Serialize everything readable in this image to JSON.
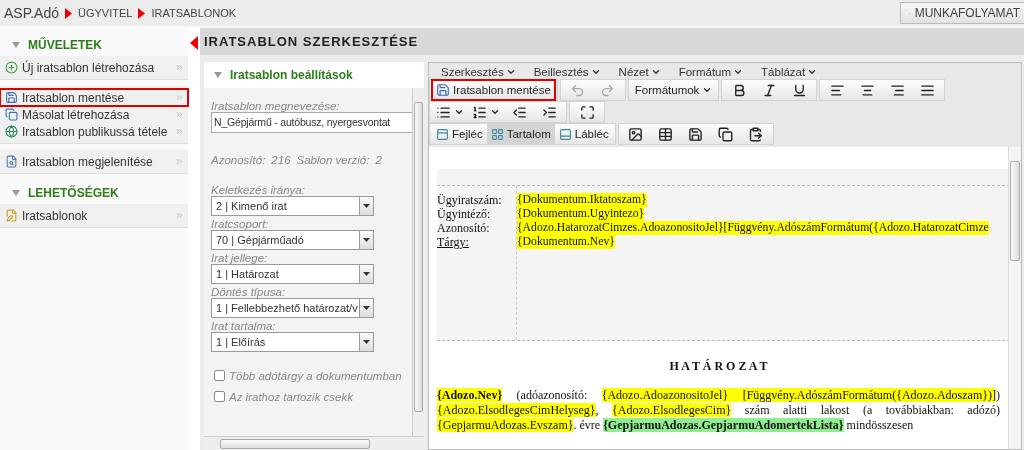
{
  "breadcrumb": [
    {
      "label": "ASP.Adó"
    },
    {
      "label": "ÜGYVITEL"
    },
    {
      "label": "IRATSABLONOK"
    }
  ],
  "workflow_button": {
    "label": "MUNKAFOLYAMAT"
  },
  "sidebar": {
    "sections": [
      {
        "title": "MŰVELETEK",
        "expanded": true,
        "groups": [
          [
            {
              "kind": "add",
              "label": "Új iratsablon létrehozása",
              "highlighted": false
            }
          ],
          [
            {
              "kind": "save",
              "label": "Iratsablon mentése",
              "highlighted": true
            },
            {
              "kind": "copy",
              "label": "Másolat létrehozása",
              "highlighted": false
            },
            {
              "kind": "publish",
              "label": "Iratsablon publikussá tétele",
              "highlighted": false
            }
          ],
          [
            {
              "kind": "view",
              "label": "Iratsablon megjelenítése",
              "highlighted": false
            }
          ]
        ]
      },
      {
        "title": "LEHETŐSÉGEK",
        "expanded": true,
        "groups": [
          [
            {
              "kind": "edit",
              "label": "Iratsablonok",
              "highlighted": false
            }
          ]
        ]
      }
    ]
  },
  "page_title": "IRATSABLON SZERKESZTÉSE",
  "settings": {
    "title": "Iratsablon beállítások",
    "expanded": true,
    "name_field": {
      "label": "Iratsablon megnevezése:",
      "value": "N_Gépjármű - autóbusz, nyergesvontat"
    },
    "info": [
      {
        "label": "Azonosító:",
        "value": "216"
      },
      {
        "label": "Sablon verzió:",
        "value": "2"
      }
    ],
    "selects": [
      {
        "label": "Keletkezés iránya:",
        "value": "2 | Kimenő irat"
      },
      {
        "label": "Iratcsoport:",
        "value": "70 | Gépjárműadó"
      },
      {
        "label": "Irat jellege:",
        "value": "1 | Határozat"
      },
      {
        "label": "Döntés típusa:",
        "value": "1 | Fellebbezhető határozat/v"
      },
      {
        "label": "Irat tartalma:",
        "value": "1 | Előírás"
      }
    ],
    "checkboxes": [
      {
        "label": "Több adótárgy a dokumentumban",
        "checked": false
      },
      {
        "label": "Az irathoz tartozik csekk",
        "checked": false
      }
    ]
  },
  "editor": {
    "menus": [
      {
        "label": "Szerkesztés"
      },
      {
        "label": "Beillesztés"
      },
      {
        "label": "Nézet"
      },
      {
        "label": "Formátum"
      },
      {
        "label": "Táblázat"
      }
    ],
    "save_button": {
      "label": "Iratsablon mentése",
      "highlighted": true
    },
    "history_tools": [
      {
        "kind": "undo",
        "disabled": true
      },
      {
        "kind": "redo",
        "disabled": true
      }
    ],
    "format_dropdown": {
      "label": "Formátumok"
    },
    "style_tools": [
      {
        "kind": "bold",
        "disabled": false
      },
      {
        "kind": "italic",
        "disabled": false
      },
      {
        "kind": "underline",
        "disabled": false
      }
    ],
    "align_tools": [
      {
        "kind": "align-left",
        "disabled": false
      },
      {
        "kind": "align-center",
        "disabled": false
      },
      {
        "kind": "align-right",
        "disabled": false
      },
      {
        "kind": "align-justify",
        "disabled": false
      }
    ],
    "list_tools": [
      {
        "kind": "bullet-list",
        "disabled": false
      },
      {
        "kind": "numbered-list",
        "disabled": false
      }
    ],
    "indent_tools": [
      {
        "kind": "outdent",
        "disabled": false
      },
      {
        "kind": "indent",
        "disabled": false
      }
    ],
    "view_tools": [
      {
        "kind": "fullscreen",
        "disabled": false
      }
    ],
    "tabs": [
      {
        "kind": "header",
        "label": "Fejléc",
        "selected": false
      },
      {
        "kind": "content",
        "label": "Tartalom",
        "selected": true
      },
      {
        "kind": "footer",
        "label": "Lábléc",
        "selected": false
      }
    ],
    "insert_tools": [
      {
        "kind": "image",
        "disabled": false
      },
      {
        "kind": "table",
        "disabled": false
      },
      {
        "kind": "save",
        "disabled": false
      },
      {
        "kind": "copy",
        "disabled": false
      },
      {
        "kind": "paste",
        "disabled": false
      }
    ],
    "document": {
      "header_rows": [
        {
          "label": "Ügyiratszám:",
          "value": "{Dokumentum.Iktatoszam}",
          "underlined": false
        },
        {
          "label": "Ügyintéző:",
          "value": "{Dokumentum.Ugyintezo}",
          "underlined": false
        },
        {
          "label": "Azonosító:",
          "value": "{Adozo.HatarozatCimzes.AdoazonositoJel}[Függvény.AdószámFormátum({Adozo.HatarozatCimze",
          "underlined": false
        },
        {
          "label": "Tárgy:",
          "value": "{Dokumentum.Nev}",
          "underlined": true
        }
      ],
      "heading": "H A T Á R O Z A T",
      "paragraph": [
        {
          "kind": "field",
          "text": "{Adozo.Nev}",
          "bold": true
        },
        {
          "kind": "text",
          "text": " (adóazonosító: ",
          "bold": false
        },
        {
          "kind": "field",
          "text": "{Adozo.AdoazonositoJel} ",
          "bold": false
        },
        {
          "kind": "field",
          "text": "[Függvény.AdószámFormátum({Adozo.Adoszam})]",
          "bold": false
        },
        {
          "kind": "text",
          "text": ") ",
          "bold": false
        },
        {
          "kind": "field",
          "text": "{Adozo.ElsodlegesCimHelyseg}",
          "bold": false
        },
        {
          "kind": "text",
          "text": ", ",
          "bold": false
        },
        {
          "kind": "field",
          "text": "{Adozo.ElsodlegesCim}",
          "bold": false
        },
        {
          "kind": "text",
          "text": " szám alatti lakost (a továbbiakban: adózó) ",
          "bold": false
        },
        {
          "kind": "field",
          "text": "{GepjarmuAdozas.Evszam}",
          "bold": false
        },
        {
          "kind": "text",
          "text": ". évre ",
          "bold": false
        },
        {
          "kind": "list",
          "text": "{GepjarmuAdozas.GepjarmuAdomertekLista}",
          "bold": true
        },
        {
          "kind": "text",
          "text": " mindösszesen",
          "bold": false
        }
      ]
    }
  }
}
